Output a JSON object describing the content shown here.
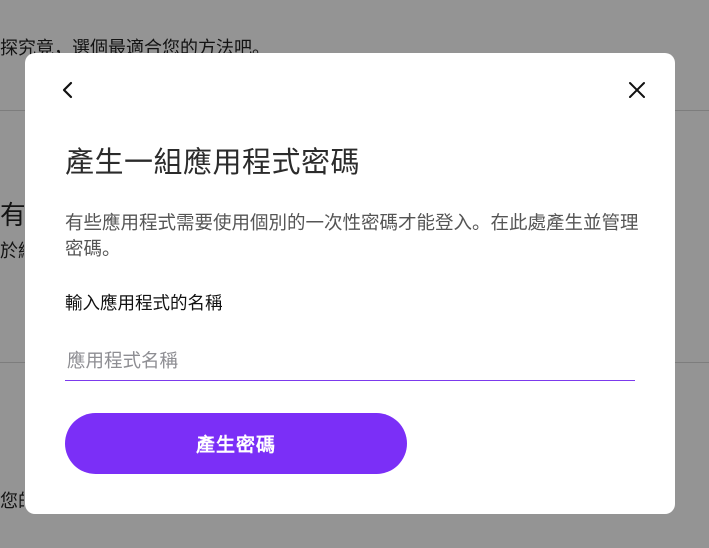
{
  "background": {
    "top_text": "探究竟，選個最適合您的方法吧。",
    "section_heading_fragment": "有安",
    "section_sub_fragment": "於網",
    "bottom_fragment": "您的"
  },
  "dialog": {
    "back_icon": "chevron-left-icon",
    "close_icon": "close-icon",
    "title": "產生一組應用程式密碼",
    "description": "有些應用程式需要使用個別的一次性密碼才能登入。在此處產生並管理密碼。",
    "input_label": "輸入應用程式的名稱",
    "input_placeholder": "應用程式名稱",
    "input_value": "",
    "primary_button": "產生密碼",
    "accent_color": "#7b2ff7"
  }
}
